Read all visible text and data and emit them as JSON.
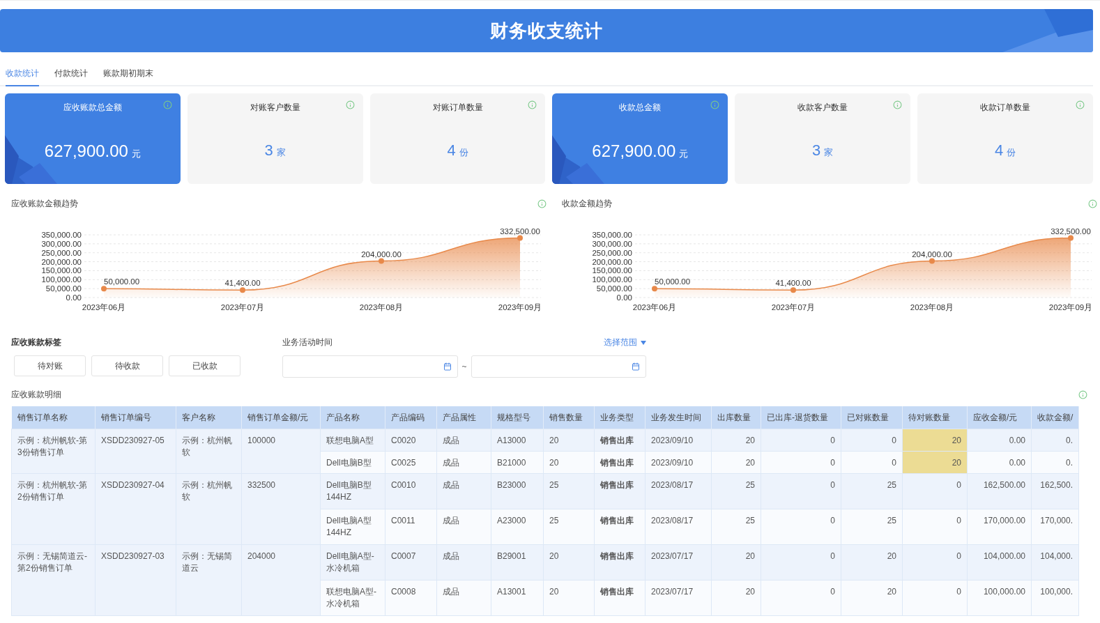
{
  "header": {
    "title": "财务收支统计"
  },
  "tabs": [
    {
      "label": "收款统计",
      "selected": true
    },
    {
      "label": "付款统计",
      "selected": false
    },
    {
      "label": "账款期初期末",
      "selected": false
    }
  ],
  "cards": [
    {
      "kind": "highlight",
      "title": "应收账款总金额",
      "value": "627,900.00",
      "unit": "元"
    },
    {
      "kind": "plain",
      "title": "对账客户数量",
      "value": "3",
      "unit": "家"
    },
    {
      "kind": "plain",
      "title": "对账订单数量",
      "value": "4",
      "unit": "份"
    },
    {
      "kind": "highlight",
      "title": "收款总金额",
      "value": "627,900.00",
      "unit": "元"
    },
    {
      "kind": "plain",
      "title": "收款客户数量",
      "value": "3",
      "unit": "家"
    },
    {
      "kind": "plain",
      "title": "收款订单数量",
      "value": "4",
      "unit": "份"
    }
  ],
  "charts": [
    {
      "title": "应收账款金额趋势",
      "chart_data": {
        "type": "area",
        "categories": [
          "2023年06月",
          "2023年07月",
          "2023年08月",
          "2023年09月"
        ],
        "series": [
          {
            "color": "#e8894a",
            "values": [
              50000,
              41400,
              204000,
              332500
            ]
          }
        ],
        "grid": true,
        "ylim": [
          0,
          350000
        ],
        "yticks": [
          {
            "value": 0,
            "label": "0.00"
          },
          {
            "value": 50000,
            "label": "50,000.00"
          },
          {
            "value": 100000,
            "label": "100,000.00"
          },
          {
            "value": 150000,
            "label": "150,000.00"
          },
          {
            "value": 200000,
            "label": "200,000.00"
          },
          {
            "value": 250000,
            "label": "250,000.00"
          },
          {
            "value": 300000,
            "label": "300,000.00"
          },
          {
            "value": 350000,
            "label": "350,000.00"
          }
        ],
        "value_labels": [
          "50,000.00",
          "41,400.00",
          "204,000.00",
          "332,500.00"
        ]
      }
    },
    {
      "title": "收款金额趋势",
      "chart_data": {
        "type": "area",
        "categories": [
          "2023年06月",
          "2023年07月",
          "2023年08月",
          "2023年09月"
        ],
        "series": [
          {
            "color": "#e8894a",
            "values": [
              50000,
              41400,
              204000,
              332500
            ]
          }
        ],
        "grid": true,
        "ylim": [
          0,
          350000
        ],
        "yticks": [
          {
            "value": 0,
            "label": "0.00"
          },
          {
            "value": 50000,
            "label": "50,000.00"
          },
          {
            "value": 100000,
            "label": "100,000.00"
          },
          {
            "value": 150000,
            "label": "150,000.00"
          },
          {
            "value": 200000,
            "label": "200,000.00"
          },
          {
            "value": 250000,
            "label": "250,000.00"
          },
          {
            "value": 300000,
            "label": "300,000.00"
          },
          {
            "value": 350000,
            "label": "350,000.00"
          }
        ],
        "value_labels": [
          "50,000.00",
          "41,400.00",
          "204,000.00",
          "332,500.00"
        ]
      }
    }
  ],
  "filters": {
    "tags_label": "应收账款标签",
    "tags": [
      "待对账",
      "待收款",
      "已收款"
    ],
    "time_label": "业务活动时间",
    "range_link": "选择范围",
    "range_separator": "~"
  },
  "detail": {
    "title": "应收账款明细",
    "columns": [
      "销售订单名称",
      "销售订单编号",
      "客户名称",
      "销售订单金额/元",
      "产品名称",
      "产品编码",
      "产品属性",
      "规格型号",
      "销售数量",
      "业务类型",
      "业务发生时间",
      "出库数量",
      "已出库-退货数量",
      "已对账数量",
      "待对账数量",
      "应收金额/元",
      "收款金额/"
    ],
    "orders": [
      {
        "name": "示例：杭州帆软-第3份销售订单",
        "number": "XSDD230927-05",
        "customer": "示例：杭州帆软",
        "amount": "100000",
        "items": [
          {
            "product": "联想电脑A型",
            "code": "C0020",
            "attr": "成品",
            "model": "A13000",
            "qty": "20",
            "type": "销售出库",
            "date": "2023/09/10",
            "out": "20",
            "returned": "0",
            "reconciled": "0",
            "pending": "20",
            "pending_highlight": true,
            "receivable": "0.00",
            "received": "0."
          },
          {
            "product": "Dell电脑B型",
            "code": "C0025",
            "attr": "成品",
            "model": "B21000",
            "qty": "20",
            "type": "销售出库",
            "date": "2023/09/10",
            "out": "20",
            "returned": "0",
            "reconciled": "0",
            "pending": "20",
            "pending_highlight": true,
            "receivable": "0.00",
            "received": "0."
          }
        ]
      },
      {
        "name": "示例：杭州帆软-第2份销售订单",
        "number": "XSDD230927-04",
        "customer": "示例：杭州帆软",
        "amount": "332500",
        "items": [
          {
            "product": "Dell电脑B型144HZ",
            "code": "C0010",
            "attr": "成品",
            "model": "B23000",
            "qty": "25",
            "type": "销售出库",
            "date": "2023/08/17",
            "out": "25",
            "returned": "0",
            "reconciled": "25",
            "pending": "0",
            "pending_highlight": false,
            "receivable": "162,500.00",
            "received": "162,500."
          },
          {
            "product": "Dell电脑A型144HZ",
            "code": "C0011",
            "attr": "成品",
            "model": "A23000",
            "qty": "25",
            "type": "销售出库",
            "date": "2023/08/17",
            "out": "25",
            "returned": "0",
            "reconciled": "25",
            "pending": "0",
            "pending_highlight": false,
            "receivable": "170,000.00",
            "received": "170,000."
          }
        ]
      },
      {
        "name": "示例：无锡简道云-第2份销售订单",
        "number": "XSDD230927-03",
        "customer": "示例：无锡简道云",
        "amount": "204000",
        "items": [
          {
            "product": "Dell电脑A型-水冷机箱",
            "code": "C0007",
            "attr": "成品",
            "model": "B29001",
            "qty": "20",
            "type": "销售出库",
            "date": "2023/07/17",
            "out": "20",
            "returned": "0",
            "reconciled": "20",
            "pending": "0",
            "pending_highlight": false,
            "receivable": "104,000.00",
            "received": "104,000."
          },
          {
            "product": "联想电脑A型-水冷机箱",
            "code": "C0008",
            "attr": "成品",
            "model": "A13001",
            "qty": "20",
            "type": "销售出库",
            "date": "2023/07/17",
            "out": "20",
            "returned": "0",
            "reconciled": "20",
            "pending": "0",
            "pending_highlight": false,
            "receivable": "100,000.00",
            "received": "100,000."
          }
        ]
      }
    ]
  }
}
